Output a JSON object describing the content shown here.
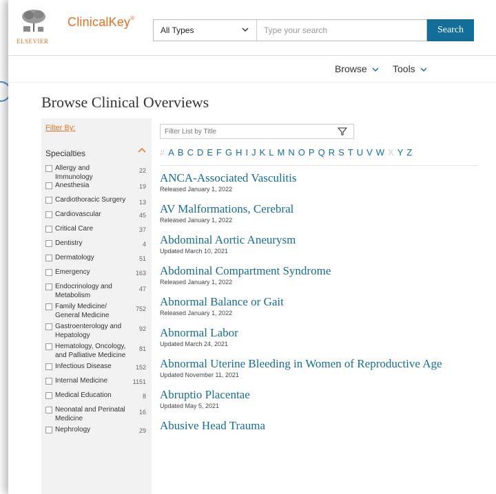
{
  "header": {
    "publisher": "ELSEVIER",
    "brand": "ClinicalKey",
    "brand_mark": "®",
    "type_select": "All Types",
    "search_placeholder": "Type your search",
    "search_button": "Search"
  },
  "nav": {
    "browse": "Browse",
    "tools": "Tools"
  },
  "page_title": "Browse Clinical Overviews",
  "sidebar": {
    "filter_by": "Filter By:",
    "specialties_label": "Specialties",
    "items": [
      {
        "label": "Allergy and Immunology",
        "count": "22"
      },
      {
        "label": "Anesthesia",
        "count": "19"
      },
      {
        "label": "Cardiothoracic Surgery",
        "count": "13"
      },
      {
        "label": "Cardiovascular",
        "count": "45"
      },
      {
        "label": "Critical Care",
        "count": "37"
      },
      {
        "label": "Dentistry",
        "count": "4"
      },
      {
        "label": "Dermatology",
        "count": "51"
      },
      {
        "label": "Emergency",
        "count": "163"
      },
      {
        "label": "Endocrinology and Metabolism",
        "count": "47"
      },
      {
        "label": "Family Medicine/ General Medicine",
        "count": "752"
      },
      {
        "label": "Gastroenterology and Hepatology",
        "count": "92"
      },
      {
        "label": "Hematology, Oncology, and Palliative Medicine",
        "count": "81"
      },
      {
        "label": "Infectious Disease",
        "count": "152"
      },
      {
        "label": "Internal Medicine",
        "count": "1151"
      },
      {
        "label": "Medical Education",
        "count": "8"
      },
      {
        "label": "Neonatal and Perinatal Medicine",
        "count": "16"
      },
      {
        "label": "Nephrology",
        "count": "29"
      }
    ]
  },
  "filter_list_placeholder": "Filter List by Title",
  "alphabet": {
    "hash": "#",
    "letters": [
      "A",
      "B",
      "C",
      "D",
      "E",
      "F",
      "G",
      "H",
      "I",
      "J",
      "K",
      "L",
      "M",
      "N",
      "O",
      "P",
      "Q",
      "R",
      "S",
      "T",
      "U",
      "V",
      "W",
      "X",
      "Y",
      "Z"
    ],
    "disabled": [
      "#",
      "X"
    ]
  },
  "entries": [
    {
      "title": "ANCA-Associated Vasculitis",
      "date": "Released January 1, 2022"
    },
    {
      "title": "AV Malformations, Cerebral",
      "date": "Released January 1, 2022"
    },
    {
      "title": "Abdominal Aortic Aneurysm",
      "date": "Updated March 10, 2021"
    },
    {
      "title": "Abdominal Compartment Syndrome",
      "date": "Released January 1, 2022"
    },
    {
      "title": "Abnormal Balance or Gait",
      "date": "Released January 1, 2022"
    },
    {
      "title": "Abnormal Labor",
      "date": "Updated March 24, 2021"
    },
    {
      "title": "Abnormal Uterine Bleeding in Women of Reproductive Age",
      "date": "Updated November 11, 2021"
    },
    {
      "title": "Abruptio Placentae",
      "date": "Updated May 5, 2021"
    },
    {
      "title": "Abusive Head Trauma",
      "date": ""
    }
  ],
  "colors": {
    "brand_orange": "#e9711c",
    "link_blue": "#136d99",
    "search_button": "#136d99"
  },
  "icons": {
    "select_chevron": "chevron-down-icon",
    "filter": "funnel-icon",
    "collapse": "chevron-up-icon"
  }
}
